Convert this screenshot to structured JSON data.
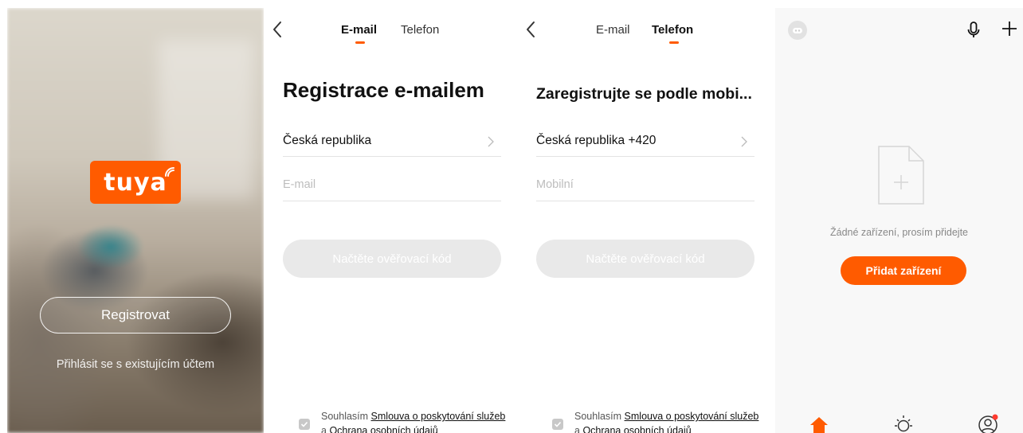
{
  "splash": {
    "logo_text": "tuya",
    "register_label": "Registrovat",
    "login_link": "Přihlásit se s existujícím účtem"
  },
  "email_screen": {
    "tabs": [
      {
        "label": "E-mail",
        "active": true
      },
      {
        "label": "Telefon",
        "active": false
      }
    ],
    "heading": "Registrace e-mailem",
    "country": "Česká republika",
    "input_placeholder": "E-mail",
    "code_button": "Načtěte ověřovací kód",
    "agree_prefix": "Souhlasím",
    "terms_link": "Smlouva o poskytování služeb",
    "agree_and": "a",
    "privacy_link": "Ochrana osobních údajů"
  },
  "phone_screen": {
    "tabs": [
      {
        "label": "E-mail",
        "active": false
      },
      {
        "label": "Telefon",
        "active": true
      }
    ],
    "heading": "Zaregistrujte se podle mobi...",
    "country": "Česká republika +420",
    "input_placeholder": "Mobilní",
    "code_button": "Načtěte ověřovací kód",
    "agree_prefix": "Souhlasím",
    "terms_link": "Smlouva o poskytování služeb",
    "agree_and": "a",
    "privacy_link": "Ochrana osobních údajů"
  },
  "home_screen": {
    "empty_text": "Žádné zařízení, prosím přidejte",
    "add_button": "Přidat zařízení",
    "nav": [
      "home-icon",
      "smart-scene-icon",
      "profile-icon"
    ]
  },
  "colors": {
    "accent": "#ff5b00",
    "disabled_button": "#e9e9e9",
    "divider": "#e3e3e3",
    "notification_dot": "#ff3b30"
  }
}
